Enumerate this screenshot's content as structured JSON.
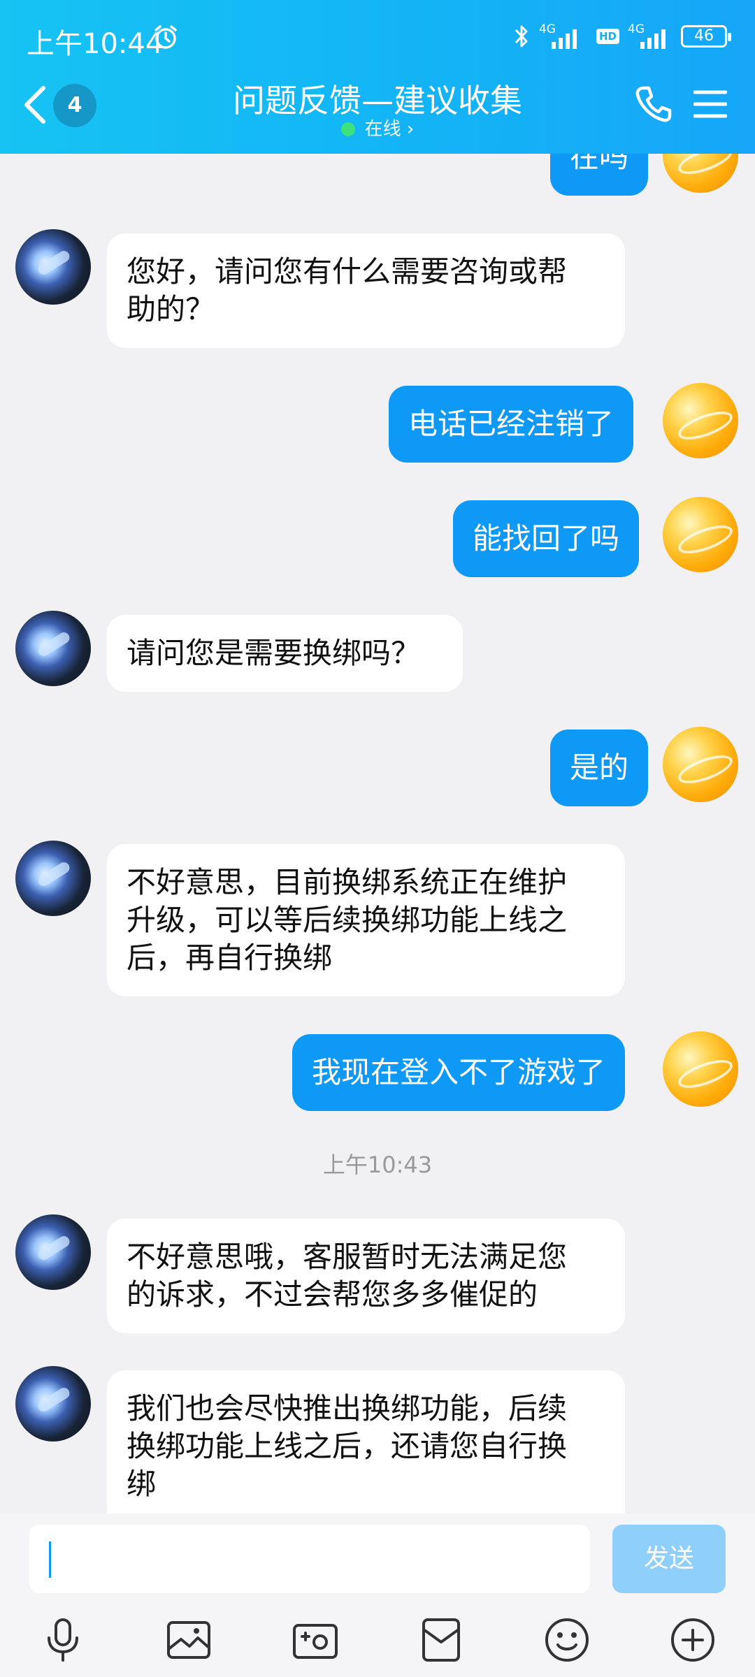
{
  "status_bar": {
    "time": "上午10:44",
    "network1": "4G",
    "network2": "4G",
    "hd": "HD",
    "battery": "46"
  },
  "header": {
    "unread_count": "4",
    "title": "问题反馈—建议收集",
    "online_status": "在线 ›"
  },
  "messages": [
    {
      "sender": "me",
      "text": "在吗"
    },
    {
      "sender": "agent",
      "lines": [
        "您好，请问您有什么需要咨询或帮",
        "助的？"
      ]
    },
    {
      "sender": "me",
      "text": "电话已经注销了"
    },
    {
      "sender": "me",
      "text": "能找回了吗"
    },
    {
      "sender": "agent",
      "lines": [
        "请问您是需要换绑吗？"
      ]
    },
    {
      "sender": "me",
      "text": "是的"
    },
    {
      "sender": "agent",
      "lines": [
        "不好意思，目前换绑系统正在维护",
        "升级，可以等后续换绑功能上线之",
        "后，再自行换绑"
      ]
    },
    {
      "sender": "me",
      "text": "我现在登入不了游戏了"
    },
    {
      "sender": "agent",
      "lines": [
        "不好意思哦，客服暂时无法满足您",
        "的诉求，不过会帮您多多催促的"
      ]
    },
    {
      "sender": "agent",
      "lines": [
        "我们也会尽快推出换绑功能，后续",
        "换绑功能上线之后，还请您自行换",
        "绑"
      ]
    }
  ],
  "time_separator": "上午10:43",
  "input": {
    "value": "",
    "send_label": "发送"
  },
  "toolbar_icons": [
    "microphone-icon",
    "image-icon",
    "camera-icon",
    "red-packet-icon",
    "emoji-icon",
    "plus-icon"
  ],
  "colors": {
    "header": "#13b4f6",
    "my_bubble": "#0f99f6",
    "send_disabled": "#8ed0fb"
  }
}
